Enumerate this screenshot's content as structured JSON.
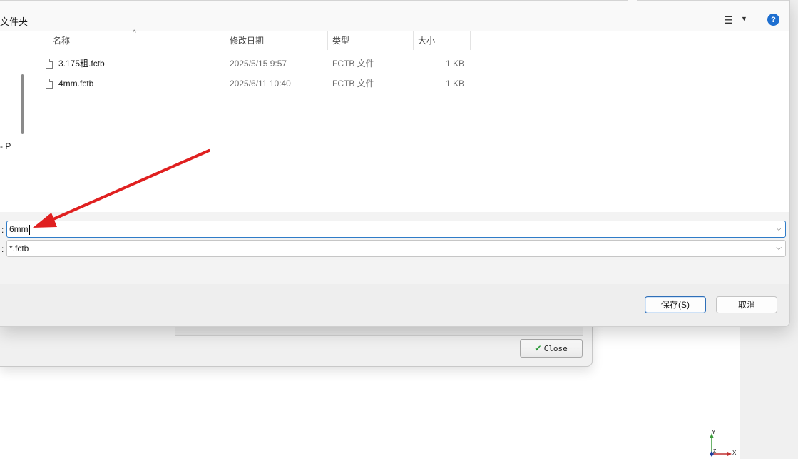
{
  "background_dialog": {
    "close_label": "Close"
  },
  "toolbar": {
    "new_folder_fragment": "文件夹",
    "view_icon": "list-view-icon",
    "help_label": "?"
  },
  "nav": {
    "fragment": "- P"
  },
  "columns": {
    "name": "名称",
    "modified": "修改日期",
    "type": "类型",
    "size": "大小"
  },
  "files": [
    {
      "name": "3.175粗.fctb",
      "modified": "2025/5/15 9:57",
      "type": "FCTB 文件",
      "size": "1 KB"
    },
    {
      "name": "4mm.fctb",
      "modified": "2025/6/11 10:40",
      "type": "FCTB 文件",
      "size": "1 KB"
    }
  ],
  "form": {
    "filename_label": ":",
    "filename_value": "6mm",
    "filetype_label": ":",
    "filetype_value": "*.fctb"
  },
  "buttons": {
    "save": "保存(S)",
    "cancel": "取消"
  },
  "gizmo": {
    "y": "Y",
    "x": "X",
    "z": "Z"
  },
  "colors": {
    "annotation_arrow": "#e02020",
    "accent": "#2f7cc8",
    "help": "#1e6fd0"
  }
}
